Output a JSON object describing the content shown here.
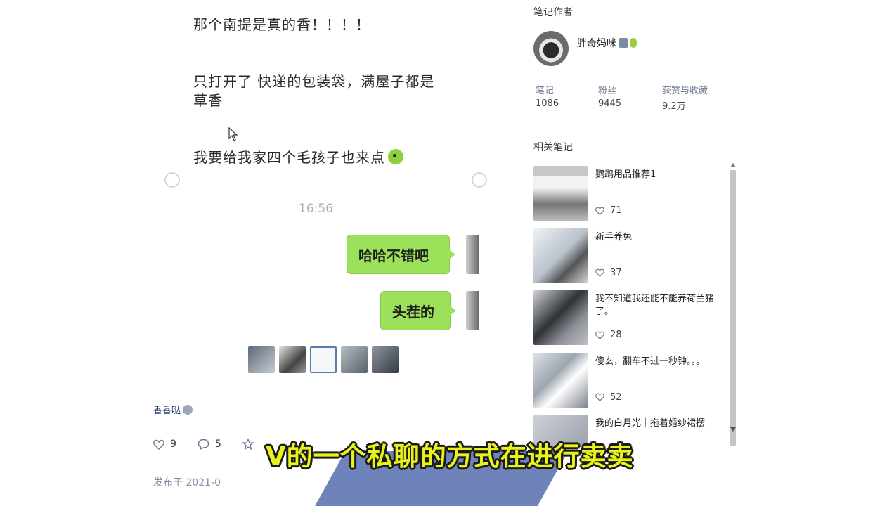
{
  "note": {
    "lines": {
      "line1": "那个南提是真的香！！！！",
      "line2": "只打开了 快递的包装袋，满屋子都是草香",
      "line3": "我要给我家四个毛孩子也来点"
    },
    "chat_time": "16:56",
    "bubbles": [
      "哈哈不错吧",
      "头茬的"
    ],
    "tag": "香香哒",
    "likes": "9",
    "comments": "5",
    "publish_time": "发布于 2021-0"
  },
  "author": {
    "section_title": "笔记作者",
    "name": "胖奇妈咪",
    "stats": [
      {
        "label": "笔记",
        "value": "1086"
      },
      {
        "label": "粉丝",
        "value": "9445"
      },
      {
        "label": "获赞与收藏",
        "value": "9.2万"
      }
    ]
  },
  "related": {
    "section_title": "相关笔记",
    "items": [
      {
        "title": "鹦鹉用品推荐1",
        "likes": "71"
      },
      {
        "title": "新手养兔",
        "likes": "37"
      },
      {
        "title": "我不知道我还能不能养荷兰猪了。",
        "likes": "28"
      },
      {
        "title": "傻玄，翻车不过一秒钟。。。",
        "likes": "52"
      },
      {
        "title": "我的白月光｜拖着婚纱裙摆",
        "likes": ""
      }
    ]
  },
  "subtitle": "V的一个私聊的方式在进行卖卖",
  "colors": {
    "bubble": "#9be15a",
    "subtitle_text": "#e9f21a",
    "subtitle_bg": "#6d83b9"
  }
}
